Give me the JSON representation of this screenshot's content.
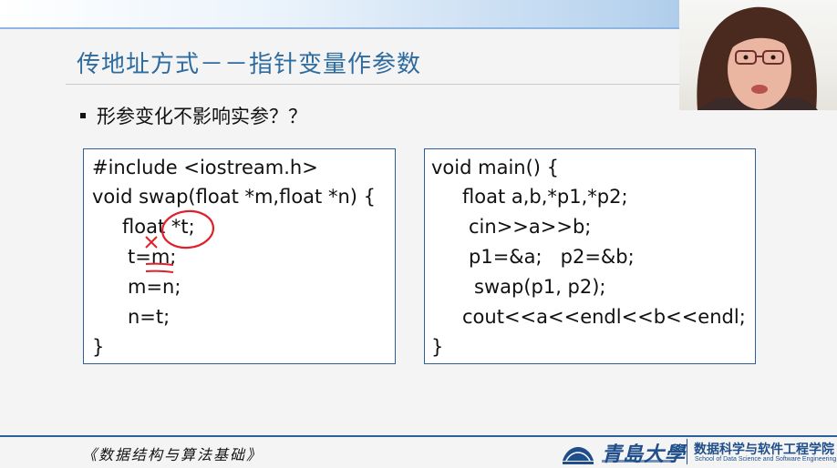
{
  "slide": {
    "title": "传地址方式－－指针变量作参数",
    "bullet": "形参变化不影响实参？？"
  },
  "code_left": {
    "lines": [
      "#include <iostream.h>",
      "void swap(float *m,float *n) {",
      "float *t;",
      "t=m;",
      "m=n;",
      "n=t;",
      "}"
    ]
  },
  "code_right": {
    "lines": [
      "void main() {",
      "float a,b,*p1,*p2;",
      "cin>>a>>b;",
      "p1=&a;   p2=&b;",
      "swap(p1, p2);",
      "cout<<a<<endl<<b<<endl;",
      "}"
    ]
  },
  "footer": {
    "course": "《数据结构与算法基础》",
    "university": "青島大學",
    "school_cn": "数据科学与软件工程学院",
    "school_en": "School of Data Science and Software Engineering"
  },
  "colors": {
    "title": "#2e6b9e",
    "box_border": "#2e5f9a",
    "annotation": "#e0202a",
    "brand": "#1f4e8a"
  },
  "icons": {
    "bullet": "square-bullet",
    "logo": "university-emblem",
    "webcam": "presenter-video"
  }
}
